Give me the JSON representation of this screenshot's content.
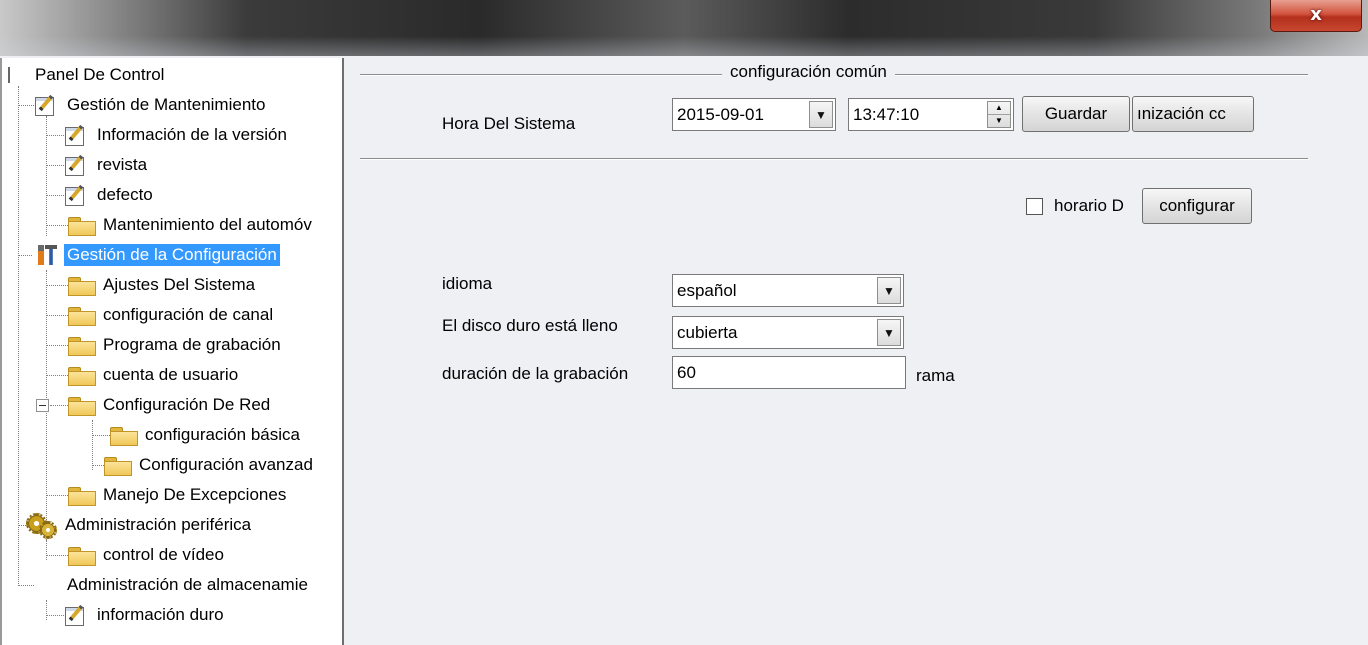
{
  "window": {
    "close_glyph": "x"
  },
  "tree": {
    "root": "Panel De Control",
    "maintenance": {
      "label": "Gestión de Mantenimiento",
      "items": [
        "Información de la versión",
        "revista",
        "defecto",
        "Mantenimiento del automóv"
      ]
    },
    "configuration": {
      "label": "Gestión de la Configuración",
      "items": [
        "Ajustes Del Sistema",
        "configuración de canal",
        "Programa de grabación",
        "cuenta de usuario"
      ],
      "network": {
        "label": "Configuración De Red",
        "items": [
          "configuración básica",
          "Configuración avanzad"
        ]
      },
      "exceptions": "Manejo De Excepciones"
    },
    "peripheral": {
      "label": "Administración periférica",
      "items": [
        "control de vídeo"
      ]
    },
    "storage": {
      "label": "Administración de almacenamie",
      "items": [
        "información duro"
      ]
    }
  },
  "panel": {
    "section_title": "configuración común",
    "system_time_label": "Hora Del Sistema",
    "date_value": "2015-09-01",
    "time_value": "13:47:10",
    "save_button": "Guardar",
    "sync_button": "ınización cc",
    "dst_label": "horario D",
    "configure_button": "configurar",
    "language_label": "idioma",
    "language_value": "español",
    "disk_full_label": "El disco duro está lleno",
    "disk_full_value": "cubierta",
    "record_duration_label": "duración de la grabación",
    "record_duration_value": "60",
    "record_duration_unit": "rama"
  }
}
